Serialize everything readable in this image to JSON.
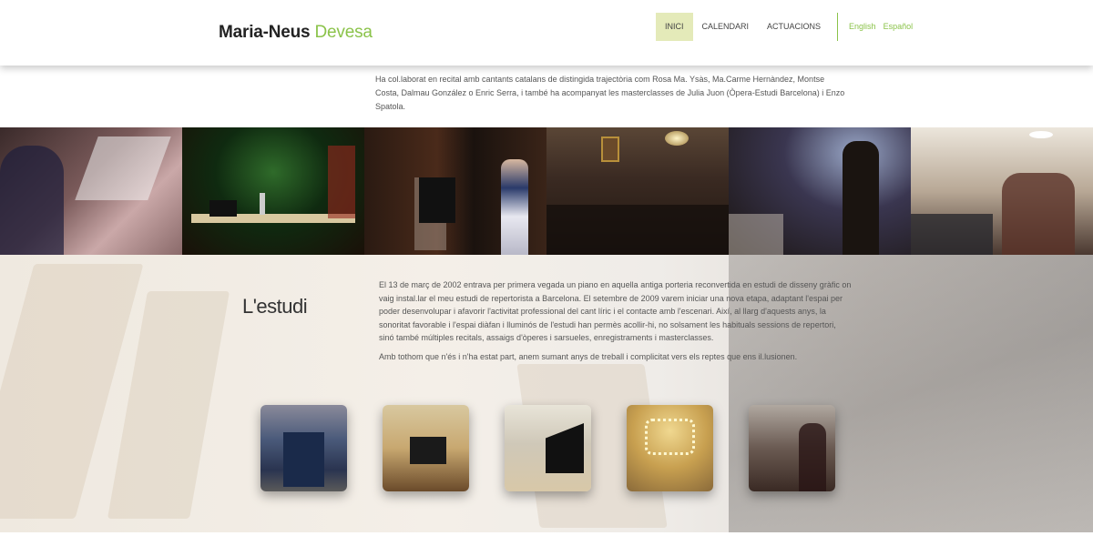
{
  "header": {
    "logo_first": "Maria-Neus",
    "logo_second": "Devesa",
    "nav": [
      {
        "label": "INICI",
        "active": true
      },
      {
        "label": "CALENDARI",
        "active": false
      },
      {
        "label": "ACTUACIONS",
        "active": false
      }
    ],
    "languages": [
      "English",
      "Español"
    ]
  },
  "intro": {
    "text": "Ha col.laborat en recital amb cantants catalans de distingida trajectòria com Rosa Ma. Ysàs, Ma.Carme Hernàndez, Montse Costa, Dalmau González o Enric Serra, i també ha acompanyat les masterclasses de Julia Juon (Òpera-Estudi Barcelona) i Enzo Spatola."
  },
  "studio": {
    "title": "L'estudi",
    "paragraph1": "El 13 de març de 2002 entrava per primera vegada un piano en aquella antiga porteria reconvertida en estudi de disseny gràfic on vaig instal.lar el meu estudi de repertorista a Barcelona. El setembre de 2009 varem iniciar una nova etapa, adaptant l'espai per poder desenvolupar i afavorir l'activitat professional del cant líric i el contacte amb l'escenari. Així, al llarg d'aquests anys, la sonoritat favorable i l'espai diàfan i lluminós de l'estudi han permès acollir-hi, no solsament les habituals sessions de repertori, sinó també múltiples recitals, assaigs d'òperes i sarsueles, enregistraments i masterclasses.",
    "paragraph2": "Amb tothom que n'és i n'ha estat part, anem sumant anys de treball i complicitat vers els reptes que ens il.lusionen."
  },
  "colors": {
    "accent": "#8bc34a",
    "nav_active_bg": "#e4eab9"
  }
}
